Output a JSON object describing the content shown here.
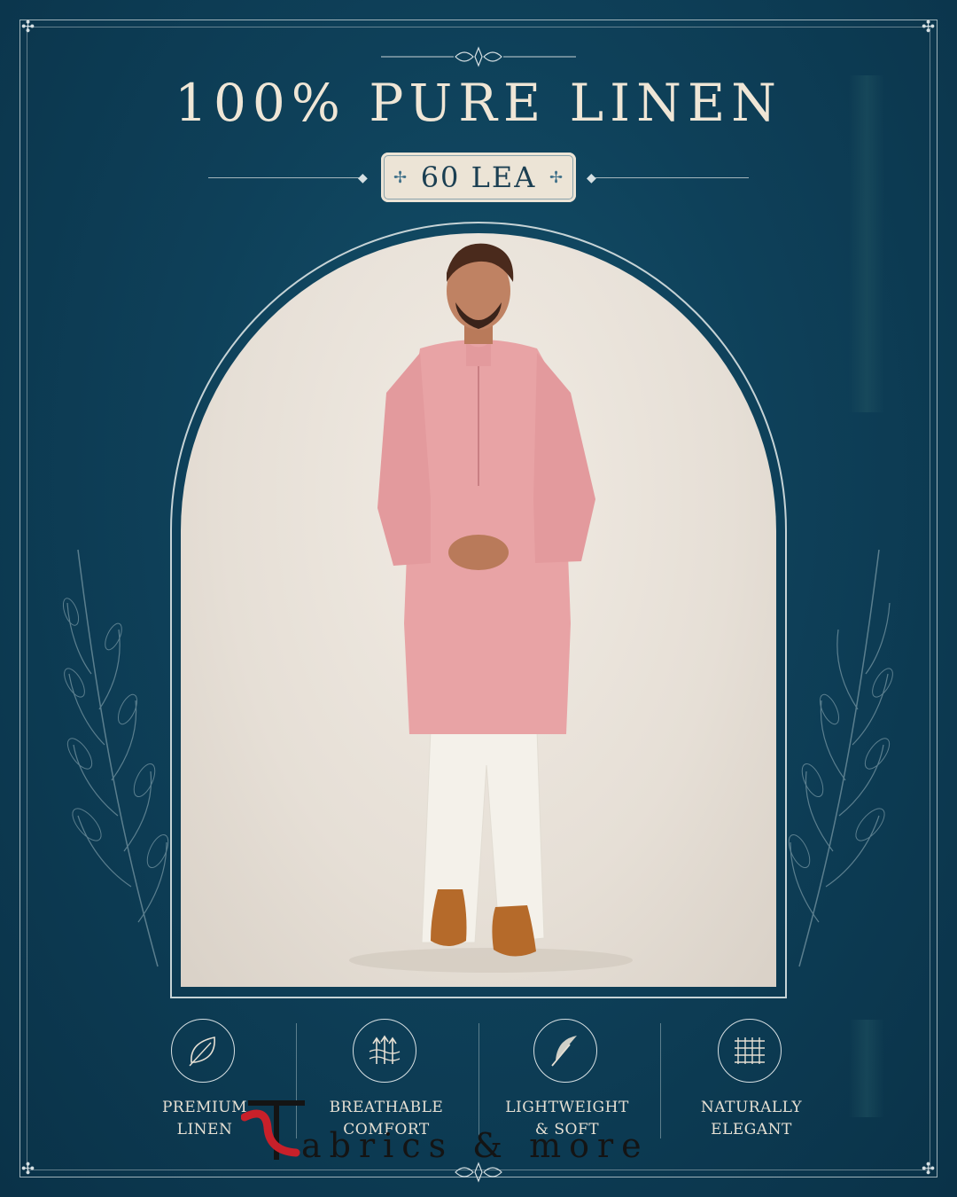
{
  "header": {
    "title": "100% PURE LINEN",
    "badge": "60 LEA"
  },
  "features": [
    {
      "icon": "leaf-icon",
      "line1": "PREMIUM",
      "line2": "LINEN"
    },
    {
      "icon": "airflow-arrows-icon",
      "line1": "BREATHABLE",
      "line2": "COMFORT"
    },
    {
      "icon": "feather-icon",
      "line1": "LIGHTWEIGHT",
      "line2": "& SOFT"
    },
    {
      "icon": "weave-grid-icon",
      "line1": "NATURALLY",
      "line2": "ELEGANT"
    }
  ],
  "logo": {
    "text": "abrics & more",
    "mark_letter": "T"
  },
  "colors": {
    "background": "#0f3d55",
    "text_cream": "#efe6d6",
    "badge_fill": "#ece4d6",
    "kurta_pink": "#e8a3a5",
    "pants_white": "#f4f1ea",
    "logo_red": "#c8202a"
  }
}
